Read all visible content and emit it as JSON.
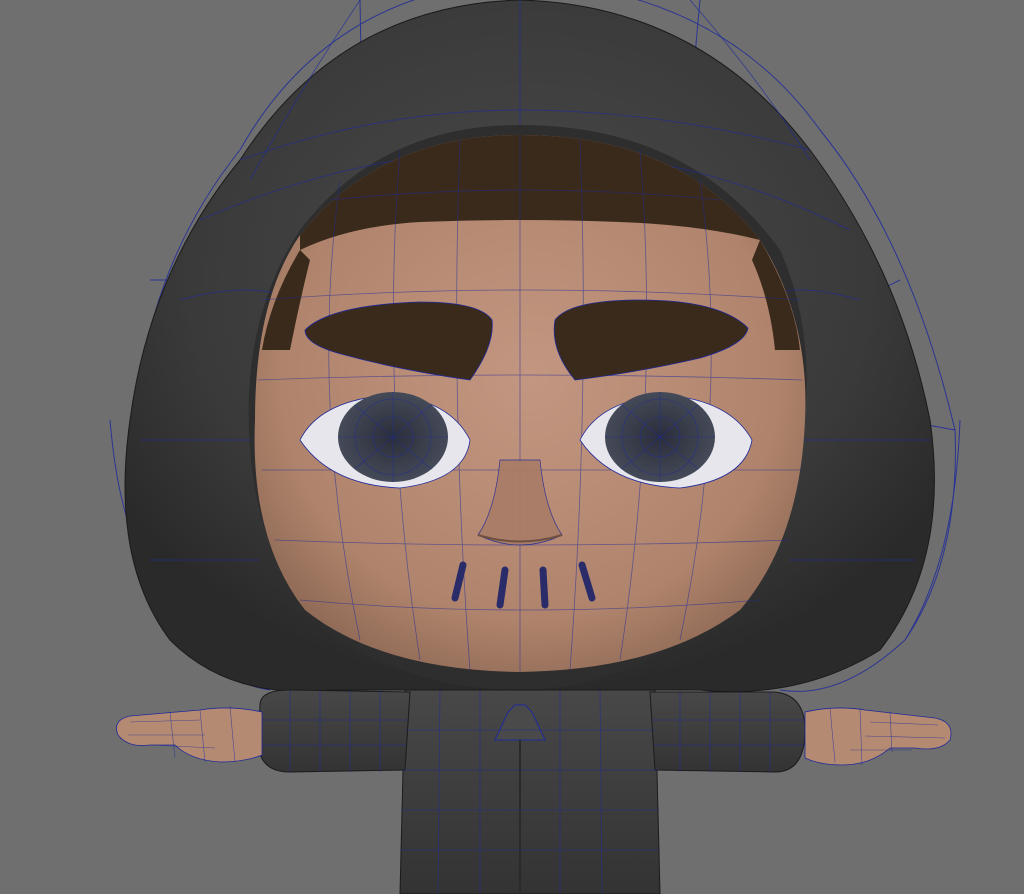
{
  "viewport": {
    "background": "#6f6f6f",
    "display_mode": "smooth-shaded-with-wireframe-on-shaded",
    "wireframe_color": "#1f2a9a"
  },
  "model": {
    "name": "",
    "pose": "T-pose",
    "parts": {
      "hood": {
        "color": "#3c3c3c"
      },
      "hair": {
        "color": "#3a2a1c"
      },
      "skin": {
        "color": "#b58a72"
      },
      "eyebrows": {
        "color": "#3a2a1c"
      },
      "eyes": {
        "sclera": "#e6e6ec",
        "iris": "#3a3e4a"
      },
      "mouth_stitches": {
        "color": "#2a2c6a",
        "count": 4
      },
      "jacket": {
        "color": "#3f3f3f"
      },
      "hands": {
        "color": "#b58a72"
      }
    }
  }
}
